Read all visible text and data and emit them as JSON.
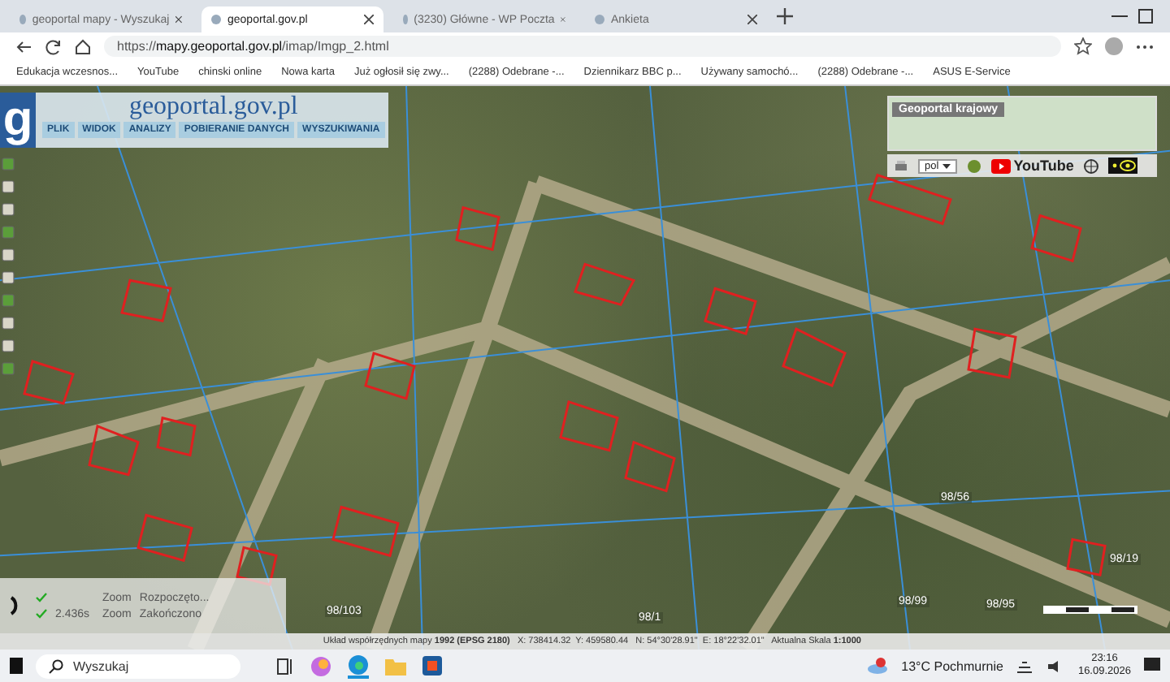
{
  "browser": {
    "tabs": [
      {
        "title": "geoportal mapy - Wyszukaj",
        "selected": false
      },
      {
        "title": "geoportal.gov.pl",
        "selected": true
      },
      {
        "title": "(3230) Główne - WP Poczta",
        "selected": false
      },
      {
        "title": "Ankieta",
        "selected": false
      }
    ],
    "address": "https://**mapy.geoportal.gov.pl**/imap/Imgp_2.html",
    "bookmarks": [
      "Edukacja wczesnos...",
      "YouTube",
      "chinski online",
      "Nowa karta",
      "Już ogłosił się zwy...",
      "(2288) Odebrane -...",
      "Dziennikarz BBC p...",
      "Używany samochó...",
      "(2288) Odebrane -...",
      "ASUS E-Service"
    ]
  },
  "geoportal": {
    "logo": "g",
    "site_title": "geoportal.gov.pl",
    "menu": [
      "PLIK",
      "WIDOK",
      "ANALIZY",
      "POBIERANIE DANYCH",
      "WYSZUKIWANIA"
    ],
    "overview_title": "Geoportal krajowy",
    "language": "pol",
    "video_label": "YouTube",
    "parcels": [
      "98/103",
      "98/1",
      "98/99",
      "98/95",
      "98/56",
      "98/19"
    ],
    "log": [
      {
        "action": "Zoom",
        "status": "Rozpoczęto..."
      },
      {
        "time": "2.436s",
        "action": "Zoom",
        "status": "Zakończono"
      }
    ],
    "status_bar": "Układ współrzędnych mapy **1992 (EPSG 2180)**   X: 738414.32  Y: 459580.44   N: 54°30'28.91\"  E: 18°22'32.01\"   Aktualna Skala **1:1000**"
  },
  "taskbar": {
    "search_placeholder": "Wyszukaj",
    "weather": "13°C  Pochmurnie",
    "time": "23:16",
    "date": "16.09.2026"
  }
}
